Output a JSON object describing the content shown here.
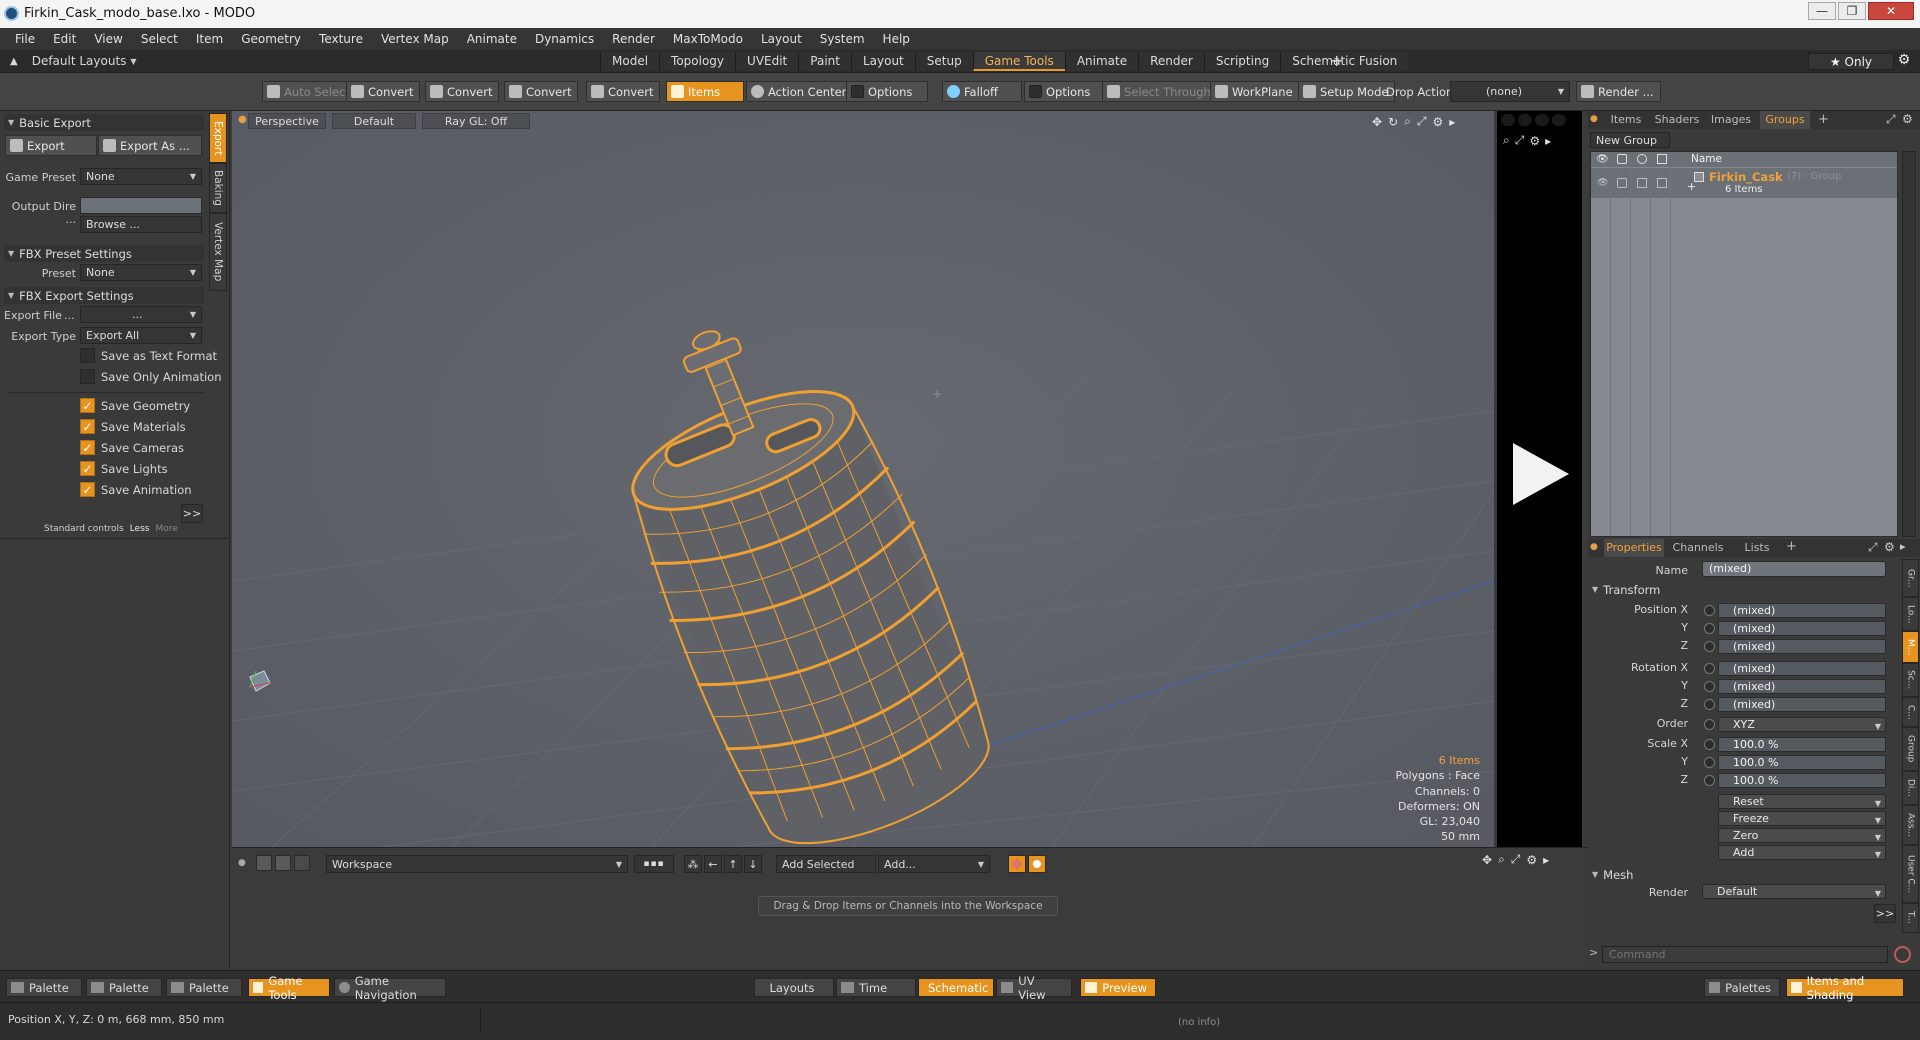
{
  "window": {
    "title": "Firkin_Cask_modo_base.lxo - MODO",
    "controls": [
      "—",
      "❐",
      "✕"
    ]
  },
  "menu": [
    "File",
    "Edit",
    "View",
    "Select",
    "Item",
    "Geometry",
    "Texture",
    "Vertex Map",
    "Animate",
    "Dynamics",
    "Render",
    "MaxToModo",
    "Layout",
    "System",
    "Help"
  ],
  "layout_bar": {
    "layout_selector": "Default Layouts",
    "tabs": [
      "Model",
      "Topology",
      "UVEdit",
      "Paint",
      "Layout",
      "Setup",
      "Game Tools",
      "Animate",
      "Render",
      "Scripting",
      "Schematic Fusion"
    ],
    "active_tab": "Game Tools",
    "only_label": "★ Only"
  },
  "toolbar": {
    "auto_select": "Auto Select",
    "convert_1": "Convert",
    "convert_2": "Convert",
    "convert_3": "Convert",
    "convert_4": "Convert",
    "items": "Items",
    "action_center": "Action Center",
    "options_1": "Options",
    "falloff": "Falloff",
    "options_2": "Options",
    "select_through": "Select Through",
    "workplane": "WorkPlane",
    "setup_mode": "Setup Mode",
    "drop_action": "Drop Action",
    "drop_value": "(none)",
    "render": "Render ..."
  },
  "left_panel": {
    "tabs": [
      "Export",
      "Baking",
      "Vertex Map"
    ],
    "basic_export": "Basic Export",
    "export_button": "Export",
    "export_as_button": "Export As ...",
    "game_preset_label": "Game Preset",
    "game_preset_value": "None",
    "output_dir_label": "Output Dire ...",
    "output_dir_value": "",
    "browse_button": "Browse ...",
    "fbx_preset_settings": "FBX Preset Settings",
    "preset_label": "Preset",
    "preset_value": "None",
    "fbx_export_settings": "FBX Export Settings",
    "export_file_label": "Export File",
    "export_file_dots": "...",
    "export_file_value": "...",
    "export_type_label": "Export Type",
    "export_type_value": "Export All",
    "checkboxes": [
      {
        "label": "Save as Text Format",
        "checked": false
      },
      {
        "label": "Save Only Animation",
        "checked": false
      },
      {
        "label": "Save Geometry",
        "checked": true
      },
      {
        "label": "Save Materials",
        "checked": true
      },
      {
        "label": "Save Cameras",
        "checked": true
      },
      {
        "label": "Save Lights",
        "checked": true
      },
      {
        "label": "Save Animation",
        "checked": true
      }
    ],
    "expand_button": ">>",
    "footer_standard": "Standard controls",
    "footer_less": "Less",
    "footer_more": "More"
  },
  "viewport": {
    "view_mode": "Perspective",
    "shading": "Default",
    "raygl": "Ray GL: Off",
    "info": {
      "items": "6 Items",
      "polygons": "Polygons : Face",
      "channels": "Channels: 0",
      "deformers": "Deformers: ON",
      "gl": "GL: 23,040",
      "scale": "50 mm"
    }
  },
  "right_panel": {
    "top_tabs": [
      "Items",
      "Shaders",
      "Images",
      "Groups"
    ],
    "active_top_tab": "Groups",
    "new_group": "New Group",
    "column_name": "Name",
    "group_name": "Firkin_Cask",
    "group_meta": "(7) : Group",
    "group_items": "6 Items",
    "bottom_tabs": [
      "Properties",
      "Channels",
      "Lists"
    ],
    "active_bottom_tab": "Properties",
    "name_label": "Name",
    "name_value": "(mixed)",
    "transform_section": "Transform",
    "position_x_label": "Position X",
    "rotation_x_label": "Rotation X",
    "scale_x_label": "Scale X",
    "y_label": "Y",
    "z_label": "Z",
    "position": [
      "(mixed)",
      "(mixed)",
      "(mixed)"
    ],
    "rotation": [
      "(mixed)",
      "(mixed)",
      "(mixed)"
    ],
    "order_label": "Order",
    "order_value": "XYZ",
    "scale": [
      "100.0 %",
      "100.0 %",
      "100.0 %"
    ],
    "actions": [
      "Reset",
      "Freeze",
      "Zero",
      "Add"
    ],
    "mesh_section": "Mesh",
    "render_label": "Render",
    "render_value": "Default",
    "expand_button": ">>",
    "command_placeholder": "Command",
    "side_tabs": [
      "Gr...",
      "Lo...",
      "M...",
      "Sc...",
      "C...",
      "Group",
      "Di...",
      "Ass...",
      "User C...",
      "T..."
    ]
  },
  "workspace": {
    "selector": "Workspace",
    "add_selected": "Add Selected",
    "add": "Add...",
    "hint": "Drag & Drop Items or Channels into the Workspace"
  },
  "bottom_bar": {
    "palette_1": "Palette",
    "palette_2": "Palette",
    "palette_3": "Palette",
    "game_tools": "Game Tools",
    "game_navigation": "Game Navigation",
    "layouts": "Layouts",
    "time": "Time",
    "schematic": "Schematic",
    "uv_view": "UV View",
    "preview": "Preview",
    "palettes": "Palettes",
    "items_and_shading": "Items and Shading"
  },
  "status": {
    "position": "Position X, Y, Z:  0 m, 668 mm, 850 mm",
    "info": "(no info)"
  },
  "colors": {
    "accent": "#e6931f",
    "wireframe": "#f0a030",
    "viewport_bg": "#5c6066"
  }
}
